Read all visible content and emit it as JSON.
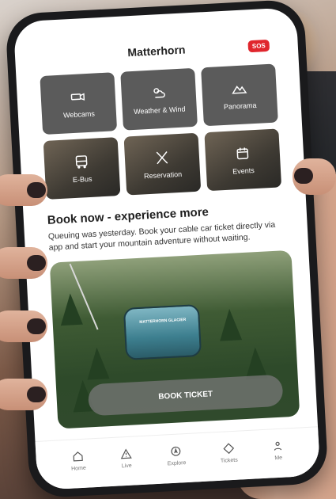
{
  "header": {
    "title": "Matterhorn",
    "sos_label": "SOS"
  },
  "tiles": [
    {
      "label": "Webcams",
      "icon": "webcam-icon"
    },
    {
      "label": "Weather & Wind",
      "icon": "weather-icon"
    },
    {
      "label": "Panorama",
      "icon": "mountain-icon"
    },
    {
      "label": "E-Bus",
      "icon": "bus-icon"
    },
    {
      "label": "Reservation",
      "icon": "cutlery-icon"
    },
    {
      "label": "Events",
      "icon": "calendar-icon"
    }
  ],
  "promo": {
    "title": "Book now - experience more",
    "text": "Queuing was yesterday. Book your cable car ticket directly via app and start your mountain adventure without waiting."
  },
  "hero": {
    "gondola_label": "MATTERHORN GLACIER",
    "button_label": "BOOK TICKET"
  },
  "nav": [
    {
      "label": "Home",
      "icon": "home-icon"
    },
    {
      "label": "Live",
      "icon": "warning-icon"
    },
    {
      "label": "Explore",
      "icon": "compass-icon"
    },
    {
      "label": "Tickets",
      "icon": "ticket-icon"
    },
    {
      "label": "Me",
      "icon": "user-icon"
    }
  ],
  "colors": {
    "accent": "#e0262d",
    "tile": "#5b5b5b"
  }
}
